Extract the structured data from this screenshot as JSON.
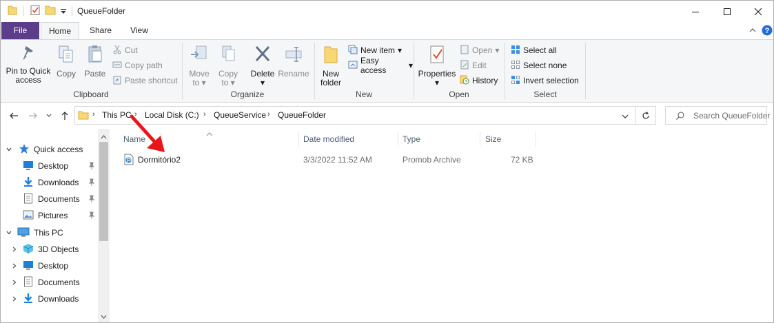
{
  "window": {
    "title": "QueueFolder"
  },
  "tabs": [
    {
      "label": "File"
    },
    {
      "label": "Home"
    },
    {
      "label": "Share"
    },
    {
      "label": "View"
    }
  ],
  "ribbon": {
    "clipboard": {
      "label": "Clipboard",
      "pin": "Pin to Quick access",
      "pin_l1": "Pin to Quick",
      "pin_l2": "access",
      "copy": "Copy",
      "paste": "Paste",
      "cut": "Cut",
      "copy_path": "Copy path",
      "paste_shortcut": "Paste shortcut"
    },
    "organize": {
      "label": "Organize",
      "move_to": "Move",
      "move_to_2": "to",
      "copy_to": "Copy",
      "copy_to_2": "to",
      "delete": "Delete",
      "rename": "Rename"
    },
    "new": {
      "label": "New",
      "new_folder_1": "New",
      "new_folder_2": "folder",
      "new_item": "New item",
      "easy_access": "Easy access"
    },
    "open": {
      "label": "Open",
      "properties": "Properties",
      "open": "Open",
      "edit": "Edit",
      "history": "History"
    },
    "select": {
      "label": "Select",
      "select_all": "Select all",
      "select_none": "Select none",
      "invert_selection": "Invert selection"
    }
  },
  "address": {
    "crumbs": [
      "This PC",
      "Local Disk (C:)",
      "QueueService",
      "QueueFolder"
    ],
    "search_placeholder": "Search QueueFolder"
  },
  "navpane": {
    "items": [
      {
        "label": "Quick access",
        "icon": "star-icon",
        "pinned": false
      },
      {
        "label": "Desktop",
        "icon": "desktop-icon",
        "pinned": true
      },
      {
        "label": "Downloads",
        "icon": "download-icon",
        "pinned": true
      },
      {
        "label": "Documents",
        "icon": "document-icon",
        "pinned": true
      },
      {
        "label": "Pictures",
        "icon": "pictures-icon",
        "pinned": true
      },
      {
        "label": "This PC",
        "icon": "computer-icon",
        "pinned": false
      },
      {
        "label": "3D Objects",
        "icon": "cube-icon",
        "pinned": false
      },
      {
        "label": "Desktop",
        "icon": "desktop-icon",
        "pinned": false
      },
      {
        "label": "Documents",
        "icon": "document-icon",
        "pinned": false
      },
      {
        "label": "Downloads",
        "icon": "download-icon",
        "pinned": false
      }
    ]
  },
  "columns": {
    "name": "Name",
    "date_modified": "Date modified",
    "type": "Type",
    "size": "Size"
  },
  "files": [
    {
      "name": "Dormitório2",
      "date_modified": "3/3/2022 11:52 AM",
      "type": "Promob Archive",
      "size": "72 KB"
    }
  ],
  "colors": {
    "file_tab": "#5b3d8c",
    "accent_blue": "#1e6fd9",
    "annotation_arrow": "#e8161b"
  }
}
